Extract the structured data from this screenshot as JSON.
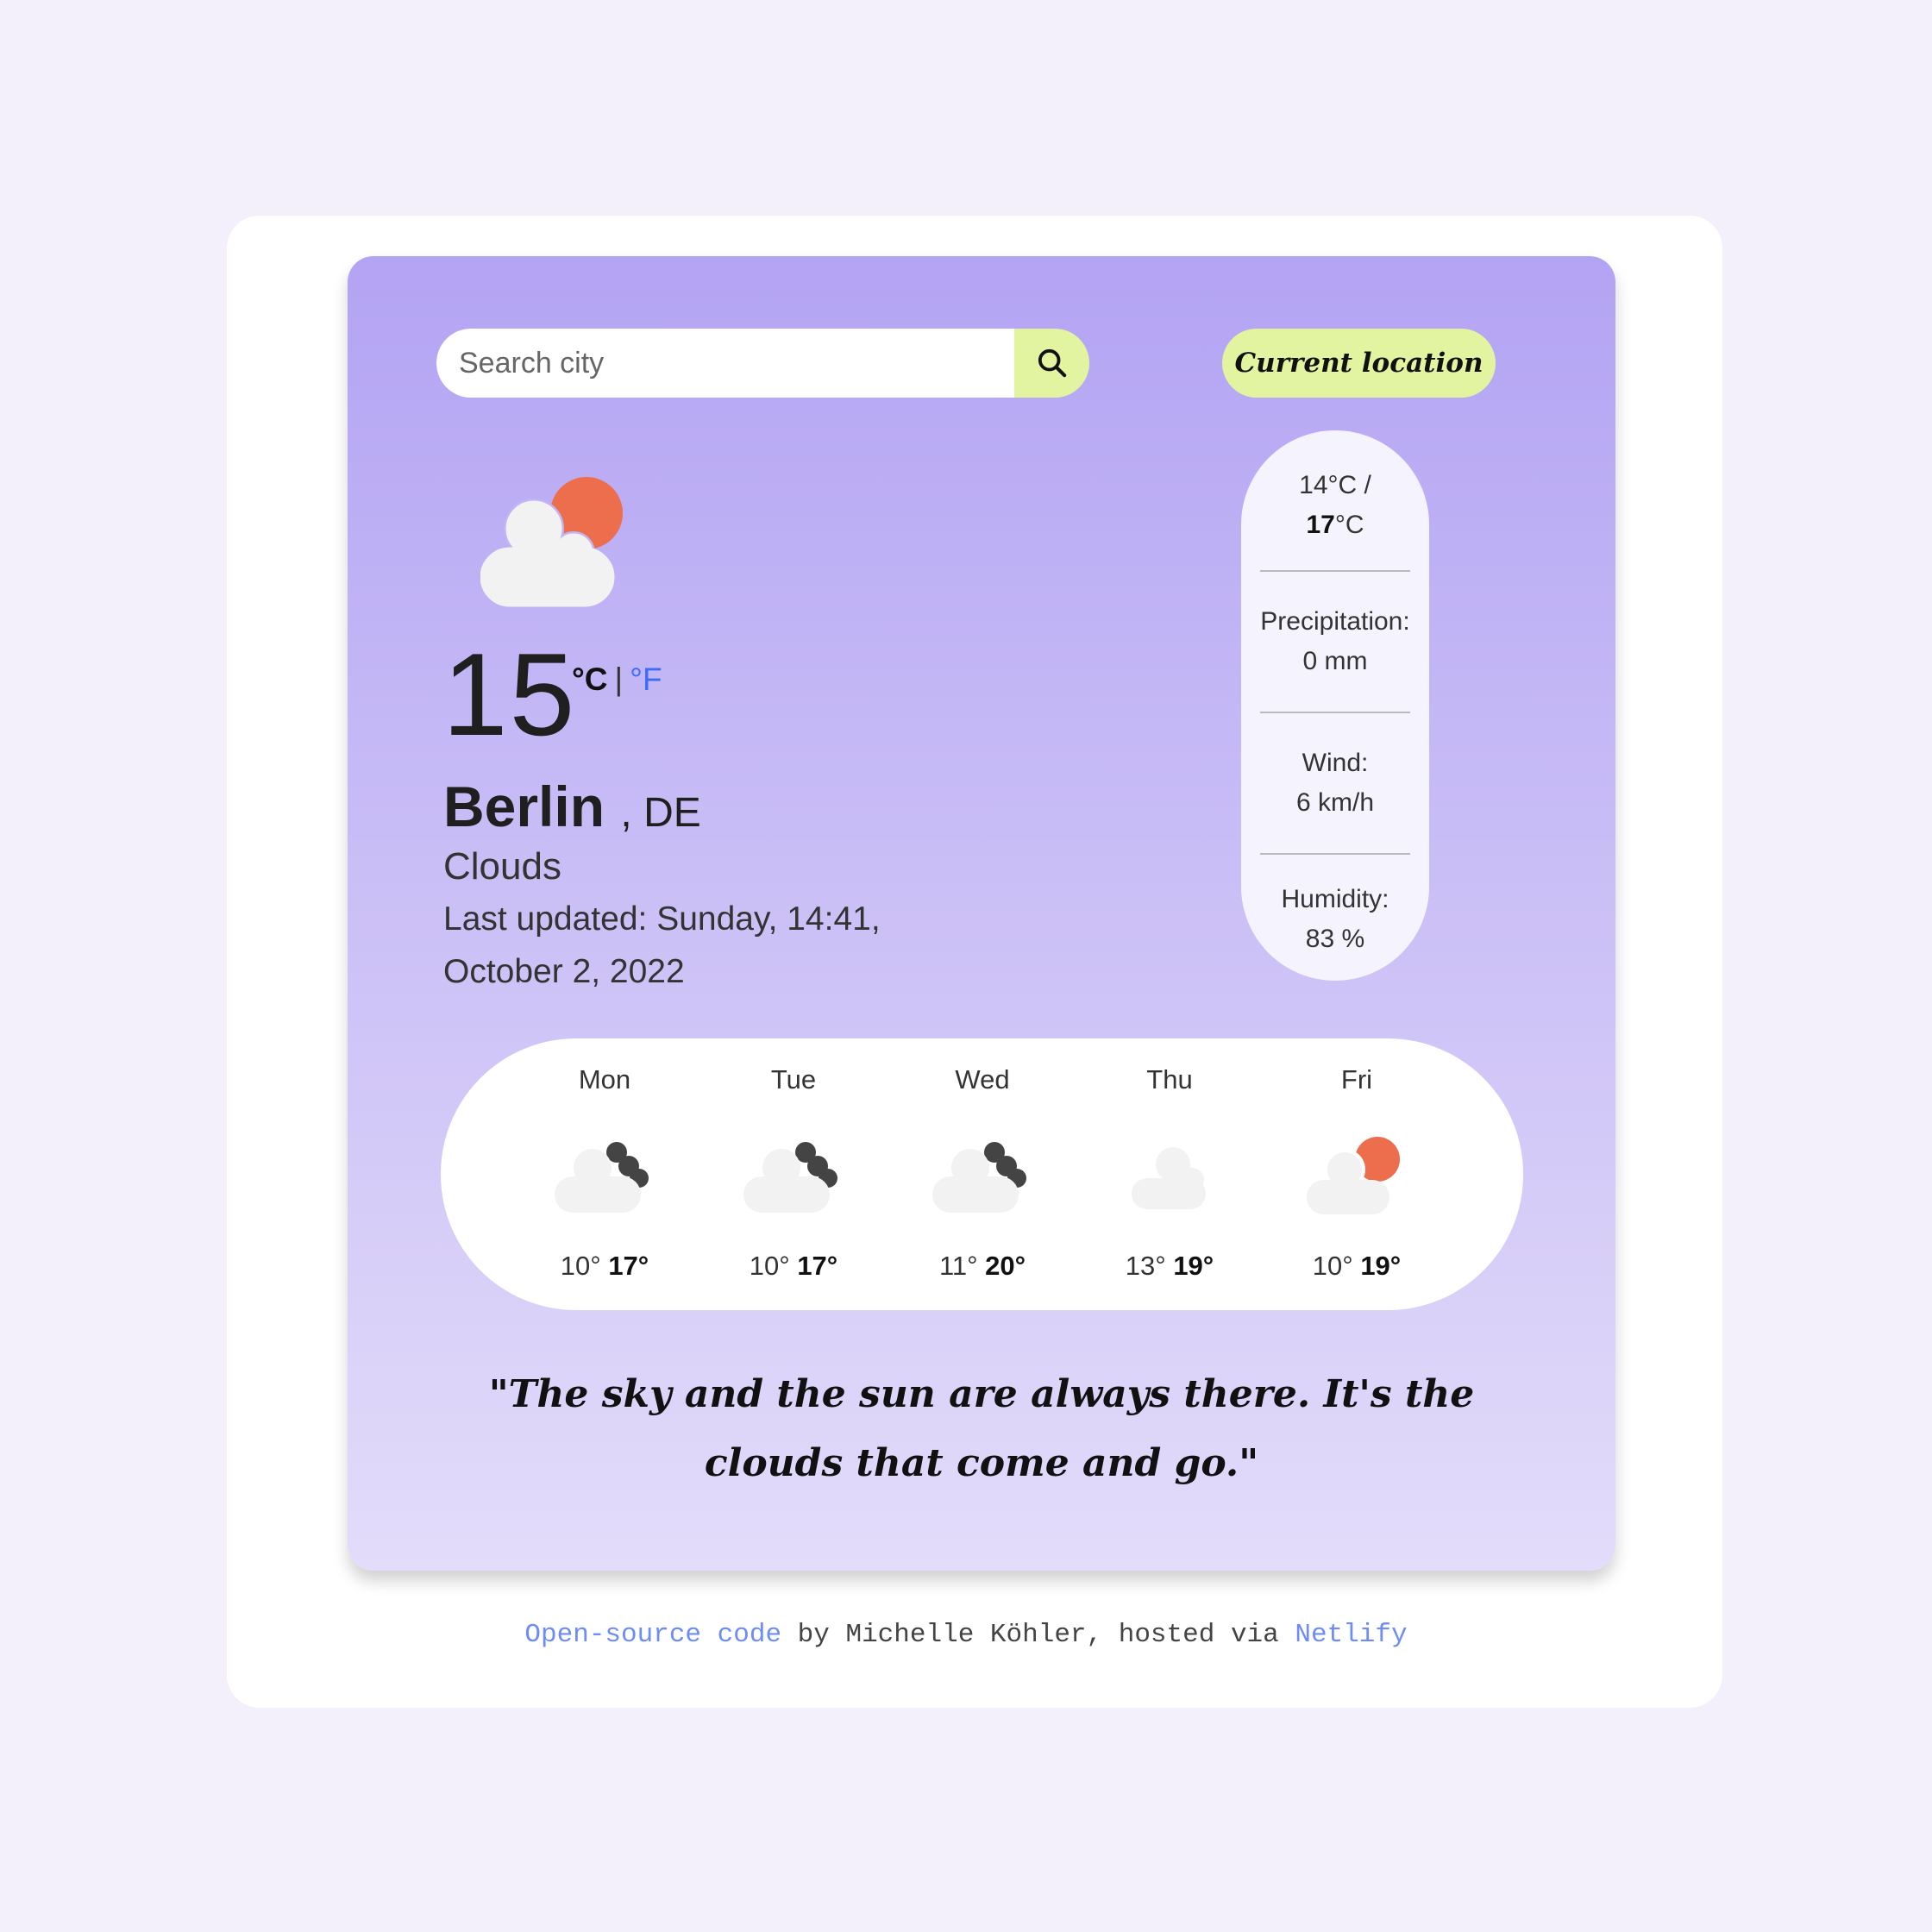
{
  "search": {
    "placeholder": "Search city",
    "icon": "search-icon"
  },
  "current_location_label": "Current location",
  "current": {
    "icon": "few-clouds-day-icon",
    "temperature": "15",
    "unit_celsius": "°C",
    "unit_separator": "|",
    "unit_fahrenheit": "°F",
    "city": "Berlin",
    "country": ", DE",
    "description": "Clouds",
    "last_updated_line1": "Last updated: Sunday, 14:41,",
    "last_updated_line2": "October 2, 2022"
  },
  "stats": {
    "temp_min": "14°C /",
    "temp_max": "17",
    "temp_max_unit": "°C",
    "precipitation_label": "Precipitation:",
    "precipitation_value": "0 mm",
    "wind_label": "Wind:",
    "wind_value": "6 km/h",
    "humidity_label": "Humidity:",
    "humidity_value": "83 %"
  },
  "forecast": [
    {
      "day": "Mon",
      "icon": "broken-clouds-icon",
      "min": "10°",
      "max": "17°"
    },
    {
      "day": "Tue",
      "icon": "broken-clouds-icon",
      "min": "10°",
      "max": "17°"
    },
    {
      "day": "Wed",
      "icon": "broken-clouds-icon",
      "min": "11°",
      "max": "20°"
    },
    {
      "day": "Thu",
      "icon": "cloud-icon",
      "min": "13°",
      "max": "19°"
    },
    {
      "day": "Fri",
      "icon": "few-clouds-day-icon",
      "min": "10°",
      "max": "19°"
    }
  ],
  "quote": "\"The sky and the sun are always there. It's the clouds that come and go.\"",
  "footer": {
    "link_code": "Open-source code",
    "by_text": " by Michelle Köhler, hosted via ",
    "link_host": "Netlify"
  },
  "colors": {
    "background": "#f3f0fc",
    "card_top": "#b3a3f3",
    "card_bottom": "#e3dcfa",
    "accent": "#e3f4a0",
    "sun": "#ec6e4c",
    "link": "#6e8cf7"
  }
}
